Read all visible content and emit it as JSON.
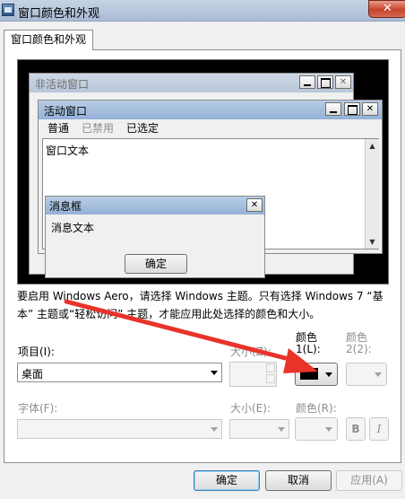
{
  "window": {
    "title": "窗口颜色和外观",
    "close_glyph": "✕"
  },
  "tab": {
    "label": "窗口颜色和外观"
  },
  "preview": {
    "inactive_window_title": "非活动窗口",
    "active_window_title": "活动窗口",
    "menu": {
      "normal": "普通",
      "disabled": "已禁用",
      "selected": "已选定"
    },
    "window_text": "窗口文本",
    "message_box": {
      "title": "消息框",
      "text": "消息文本",
      "ok": "确定"
    },
    "close_glyph": "✕"
  },
  "info": {
    "line1": "要启用 Windows Aero，请选择 Windows 主题。只有选择 Windows 7 “基",
    "line2": "本” 主题或“轻松访问” 主题，才能应用此处选择的颜色和大小。"
  },
  "item": {
    "label": "项目(I):",
    "value": "桌面",
    "size_label": "大小(Z):",
    "color1_label_line1": "颜色",
    "color1_label_line2": "1(L):",
    "color1_value": "#000000",
    "color2_label_line1": "颜色",
    "color2_label_line2": "2(2):"
  },
  "font": {
    "label": "字体(F):",
    "size_label": "大小(E):",
    "color_label": "颜色(R):",
    "bold": "B",
    "italic": "I"
  },
  "buttons": {
    "ok": "确定",
    "cancel": "取消",
    "apply": "应用(A)"
  },
  "colors": {
    "arrow": "#e8332a"
  }
}
